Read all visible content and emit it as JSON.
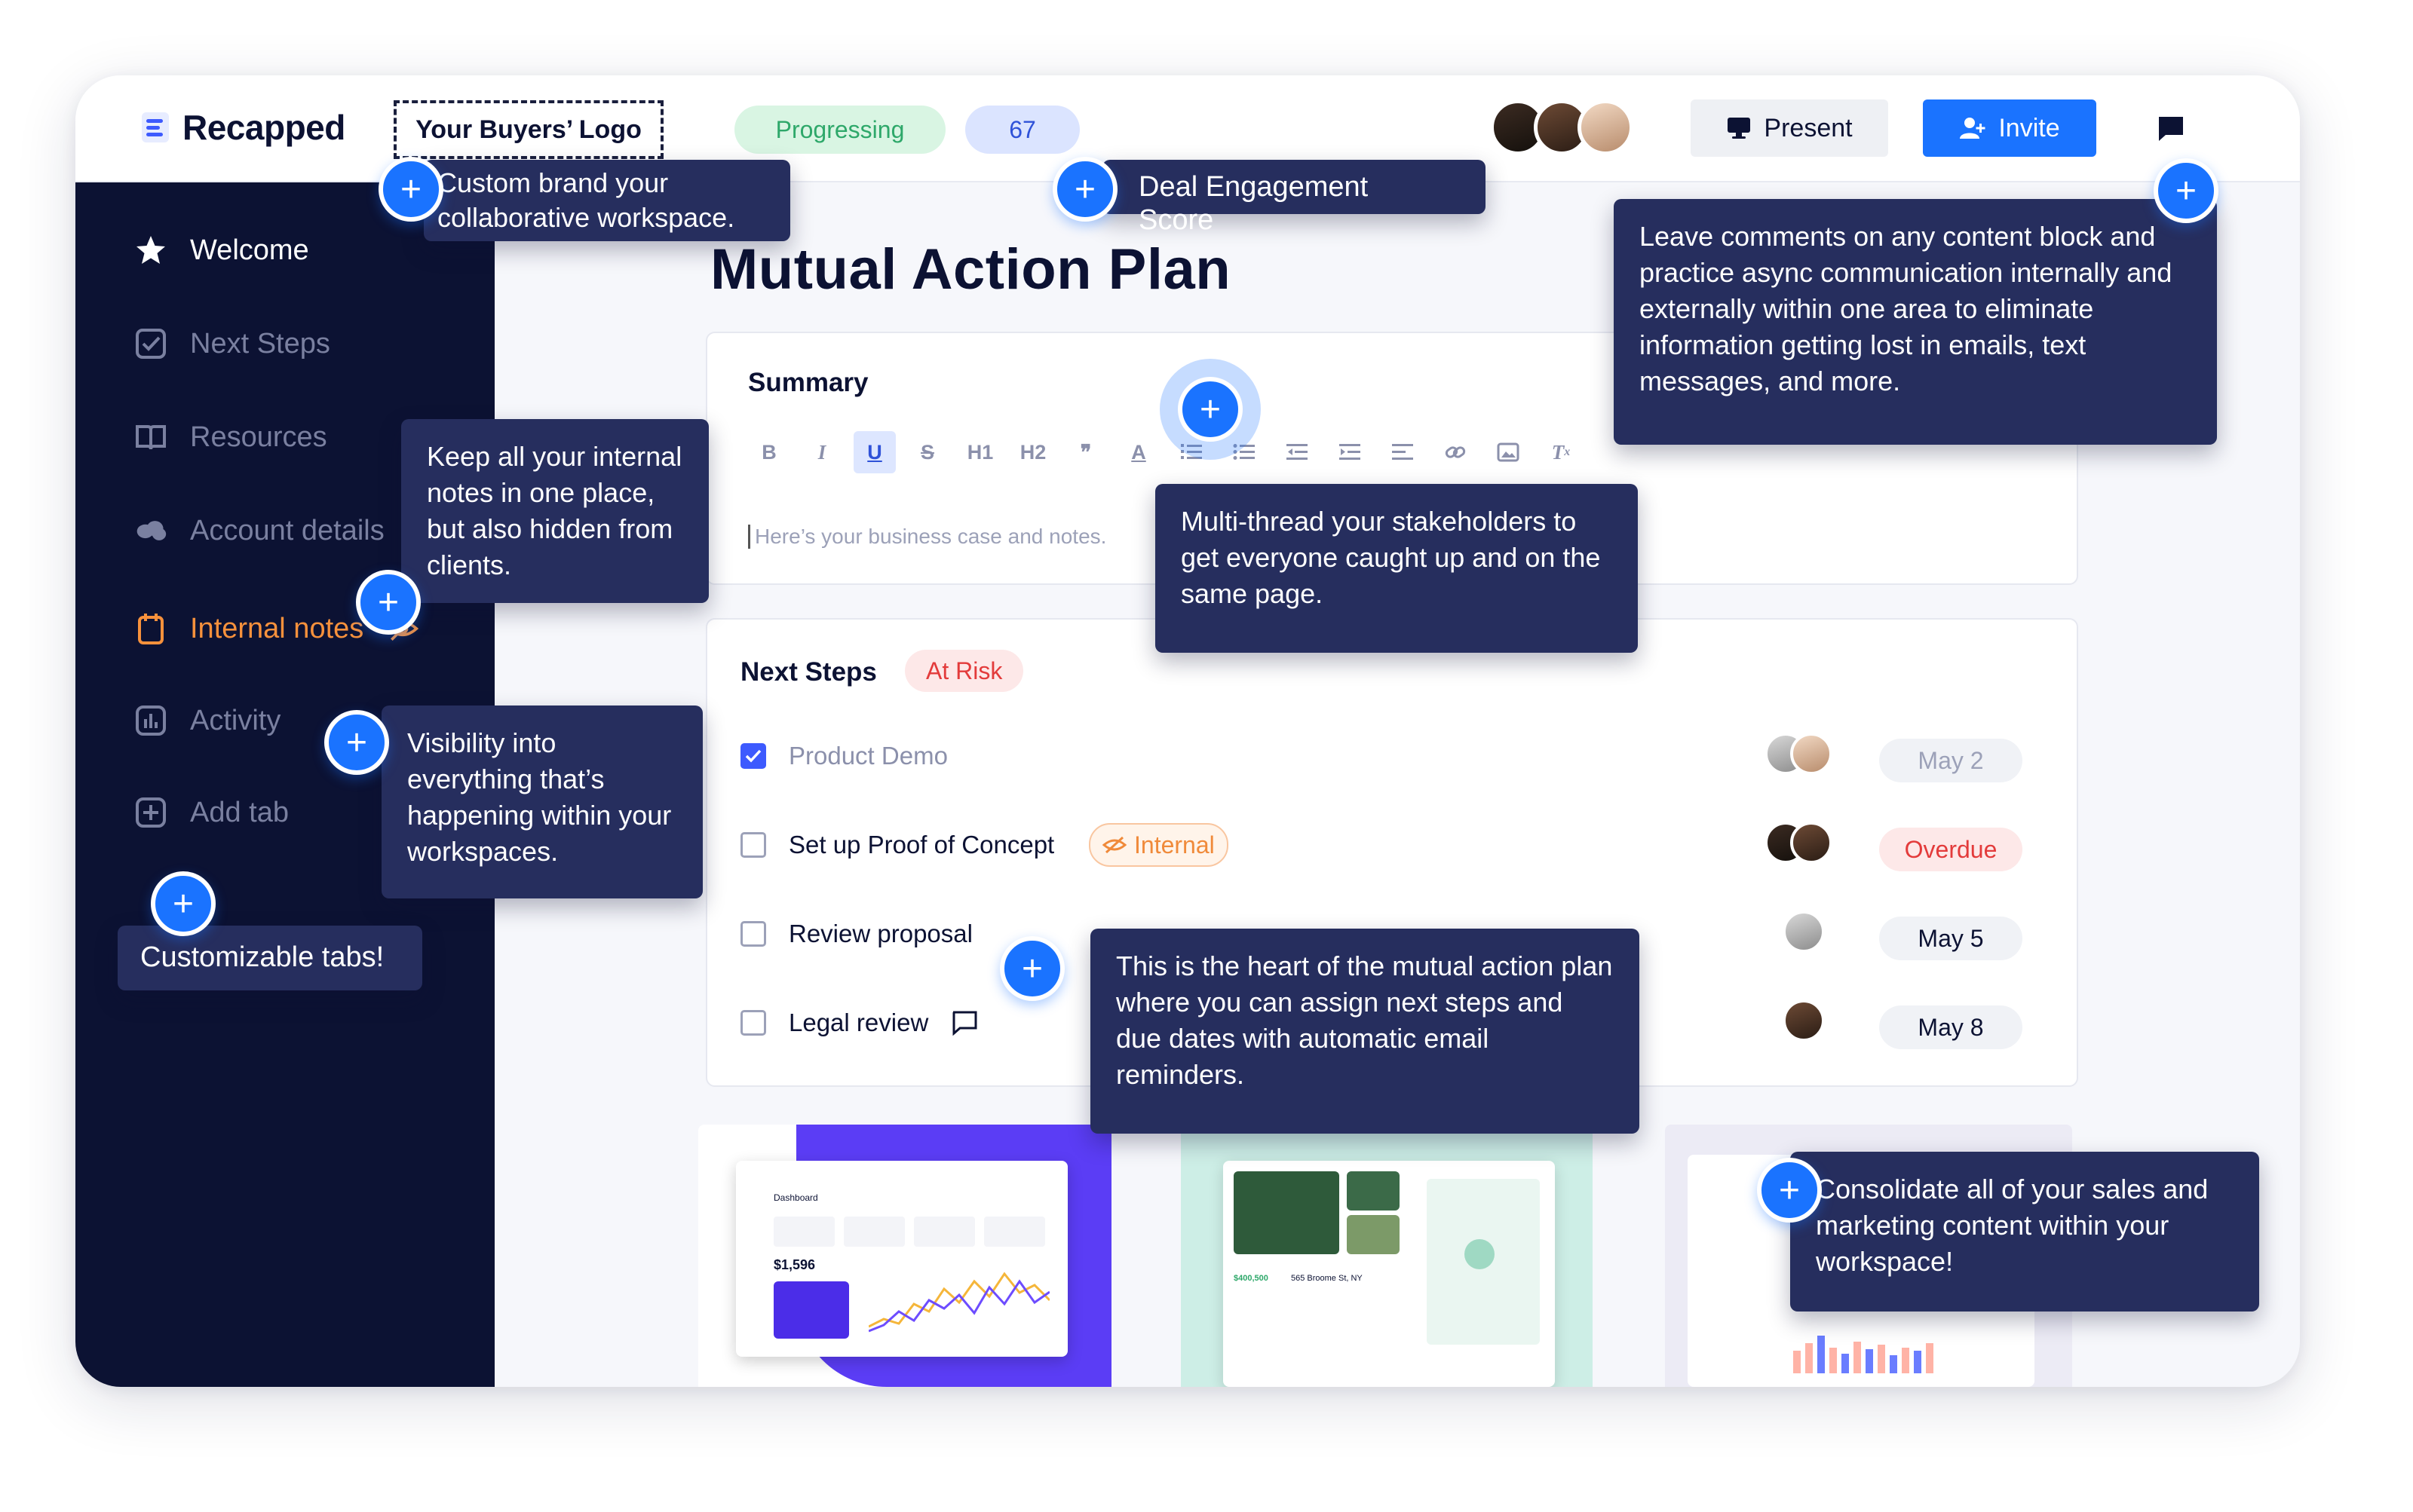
{
  "header": {
    "app_name": "Recapped",
    "buyer_logo": "Your Buyers’ Logo",
    "status": "Progressing",
    "score": "67",
    "present_label": "Present",
    "invite_label": "Invite"
  },
  "sidebar": {
    "items": [
      {
        "label": "Welcome",
        "icon": "star-icon"
      },
      {
        "label": "Next Steps",
        "icon": "checkbox-icon"
      },
      {
        "label": "Resources",
        "icon": "book-icon"
      },
      {
        "label": "Account details",
        "icon": "salesforce-icon"
      },
      {
        "label": "Internal notes",
        "icon": "notes-icon"
      },
      {
        "label": "Activity",
        "icon": "chart-icon"
      },
      {
        "label": "Add tab",
        "icon": "add-tab-icon"
      }
    ]
  },
  "main": {
    "title": "Mutual Action Plan",
    "summary": {
      "heading": "Summary",
      "toolbar": [
        "B",
        "I",
        "U",
        "S",
        "H1",
        "H2",
        "❞",
        "A"
      ],
      "placeholder": "Here’s your business case and notes."
    },
    "next_steps": {
      "heading": "Next Steps",
      "status": "At Risk",
      "items": [
        {
          "label": "Product Demo",
          "checked": true,
          "date": "May 2"
        },
        {
          "label": "Set up Proof of Concept",
          "checked": false,
          "tag": "Internal",
          "date": "Overdue"
        },
        {
          "label": "Review proposal",
          "checked": false,
          "date": "May 5"
        },
        {
          "label": "Legal review",
          "checked": false,
          "date": "May 8"
        }
      ]
    },
    "thumbnails": {
      "dashboard_title": "Dashboard",
      "dashboard_value": "$1,596",
      "listing_title": "565 Broome St, NY",
      "listing_price": "$400,500"
    }
  },
  "callouts": {
    "brand": "Custom brand your collaborative workspace.",
    "score": "Deal Engagement Score",
    "comments": "Leave comments on any content block and practice async communication internally and externally within one area to eliminate information getting lost in emails, text messages, and more.",
    "internal": "Keep all your internal notes in one place, but also hidden from clients.",
    "multithread": "Multi-thread your stakeholders to get everyone caught up and on the same page.",
    "visibility": "Visibility into everything that’s happening within your workspaces.",
    "tabs": "Customizable tabs!",
    "map": "This is the heart of the mutual action plan where you can assign next steps and due dates with automatic email reminders.",
    "content": "Consolidate all of your sales and marketing content within your workspace!"
  },
  "colors": {
    "accent": "#1a73ff",
    "sidebar": "#0c1233",
    "tooltip": "#262e5e",
    "progress": "#2ea86a",
    "risk": "#e33b3b",
    "internal": "#f7913c"
  }
}
